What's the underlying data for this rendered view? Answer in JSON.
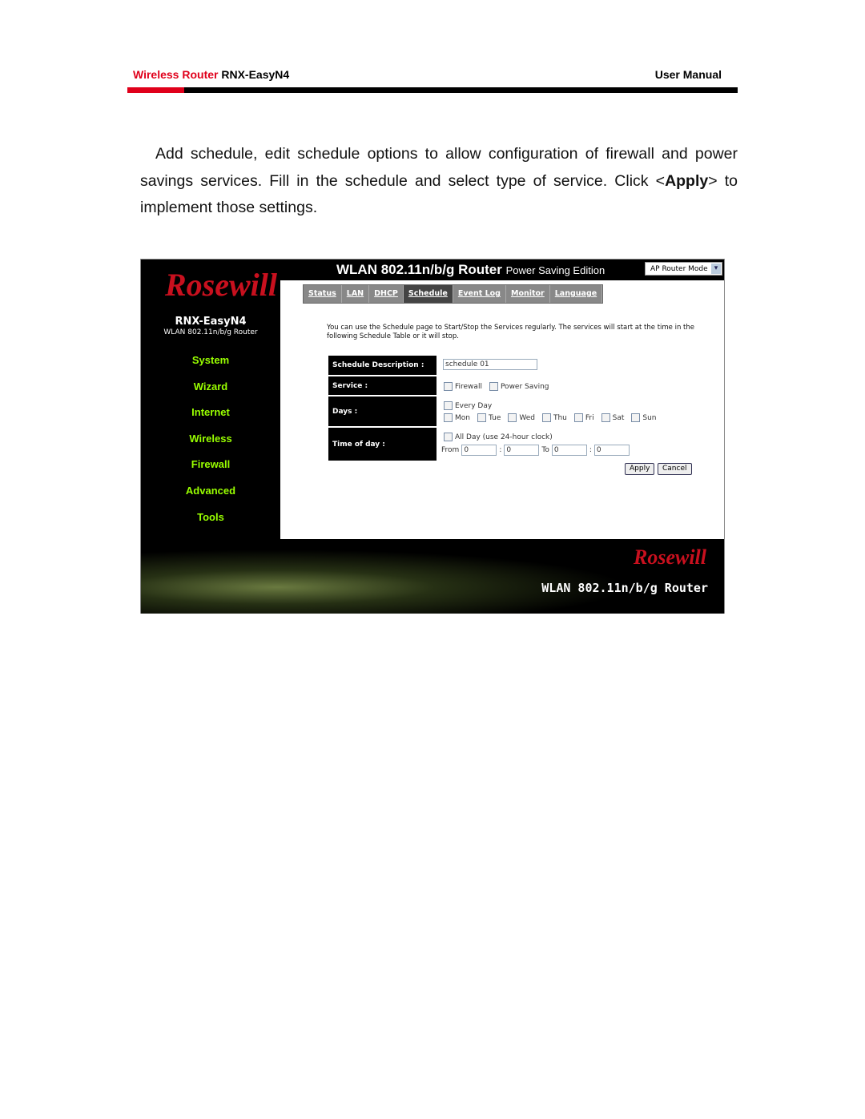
{
  "header": {
    "product_prefix": "Wireless Router",
    "product_model": "RNX-EasyN4",
    "doc_type": "User Manual"
  },
  "body": {
    "p1": "Add schedule, edit schedule options to allow configuration of firewall and power savings services. Fill in the schedule and select type of service. Click <",
    "apply": "Apply",
    "p2": "> to implement those settings."
  },
  "router": {
    "logo": "Rosewill",
    "title": "WLAN 802.11n/b/g Router",
    "title_sub": "Power Saving Edition",
    "mode": "AP Router Mode",
    "model": "RNX-EasyN4",
    "model_sub": "WLAN 802.11n/b/g Router",
    "nav": [
      "System",
      "Wizard",
      "Internet",
      "Wireless",
      "Firewall",
      "Advanced",
      "Tools"
    ],
    "tabs": [
      "Status",
      "LAN",
      "DHCP",
      "Schedule",
      "Event Log",
      "Monitor",
      "Language"
    ],
    "active_tab": "Schedule",
    "intro": "You can use the Schedule page to Start/Stop the Services regularly. The services will start at the time in the following Schedule Table or it will stop.",
    "labels": {
      "desc": "Schedule Description :",
      "service": "Service :",
      "days": "Days :",
      "time": "Time of day :"
    },
    "desc_value": "schedule 01",
    "services": [
      "Firewall",
      "Power Saving"
    ],
    "every_day": "Every Day",
    "days": [
      "Mon",
      "Tue",
      "Wed",
      "Thu",
      "Fri",
      "Sat",
      "Sun"
    ],
    "all_day": "All Day (use 24-hour clock)",
    "from": "From",
    "to": "To",
    "times": [
      "0",
      "0",
      "0",
      "0"
    ],
    "apply": "Apply",
    "cancel": "Cancel",
    "footer_title": "WLAN 802.11n/b/g Router"
  }
}
